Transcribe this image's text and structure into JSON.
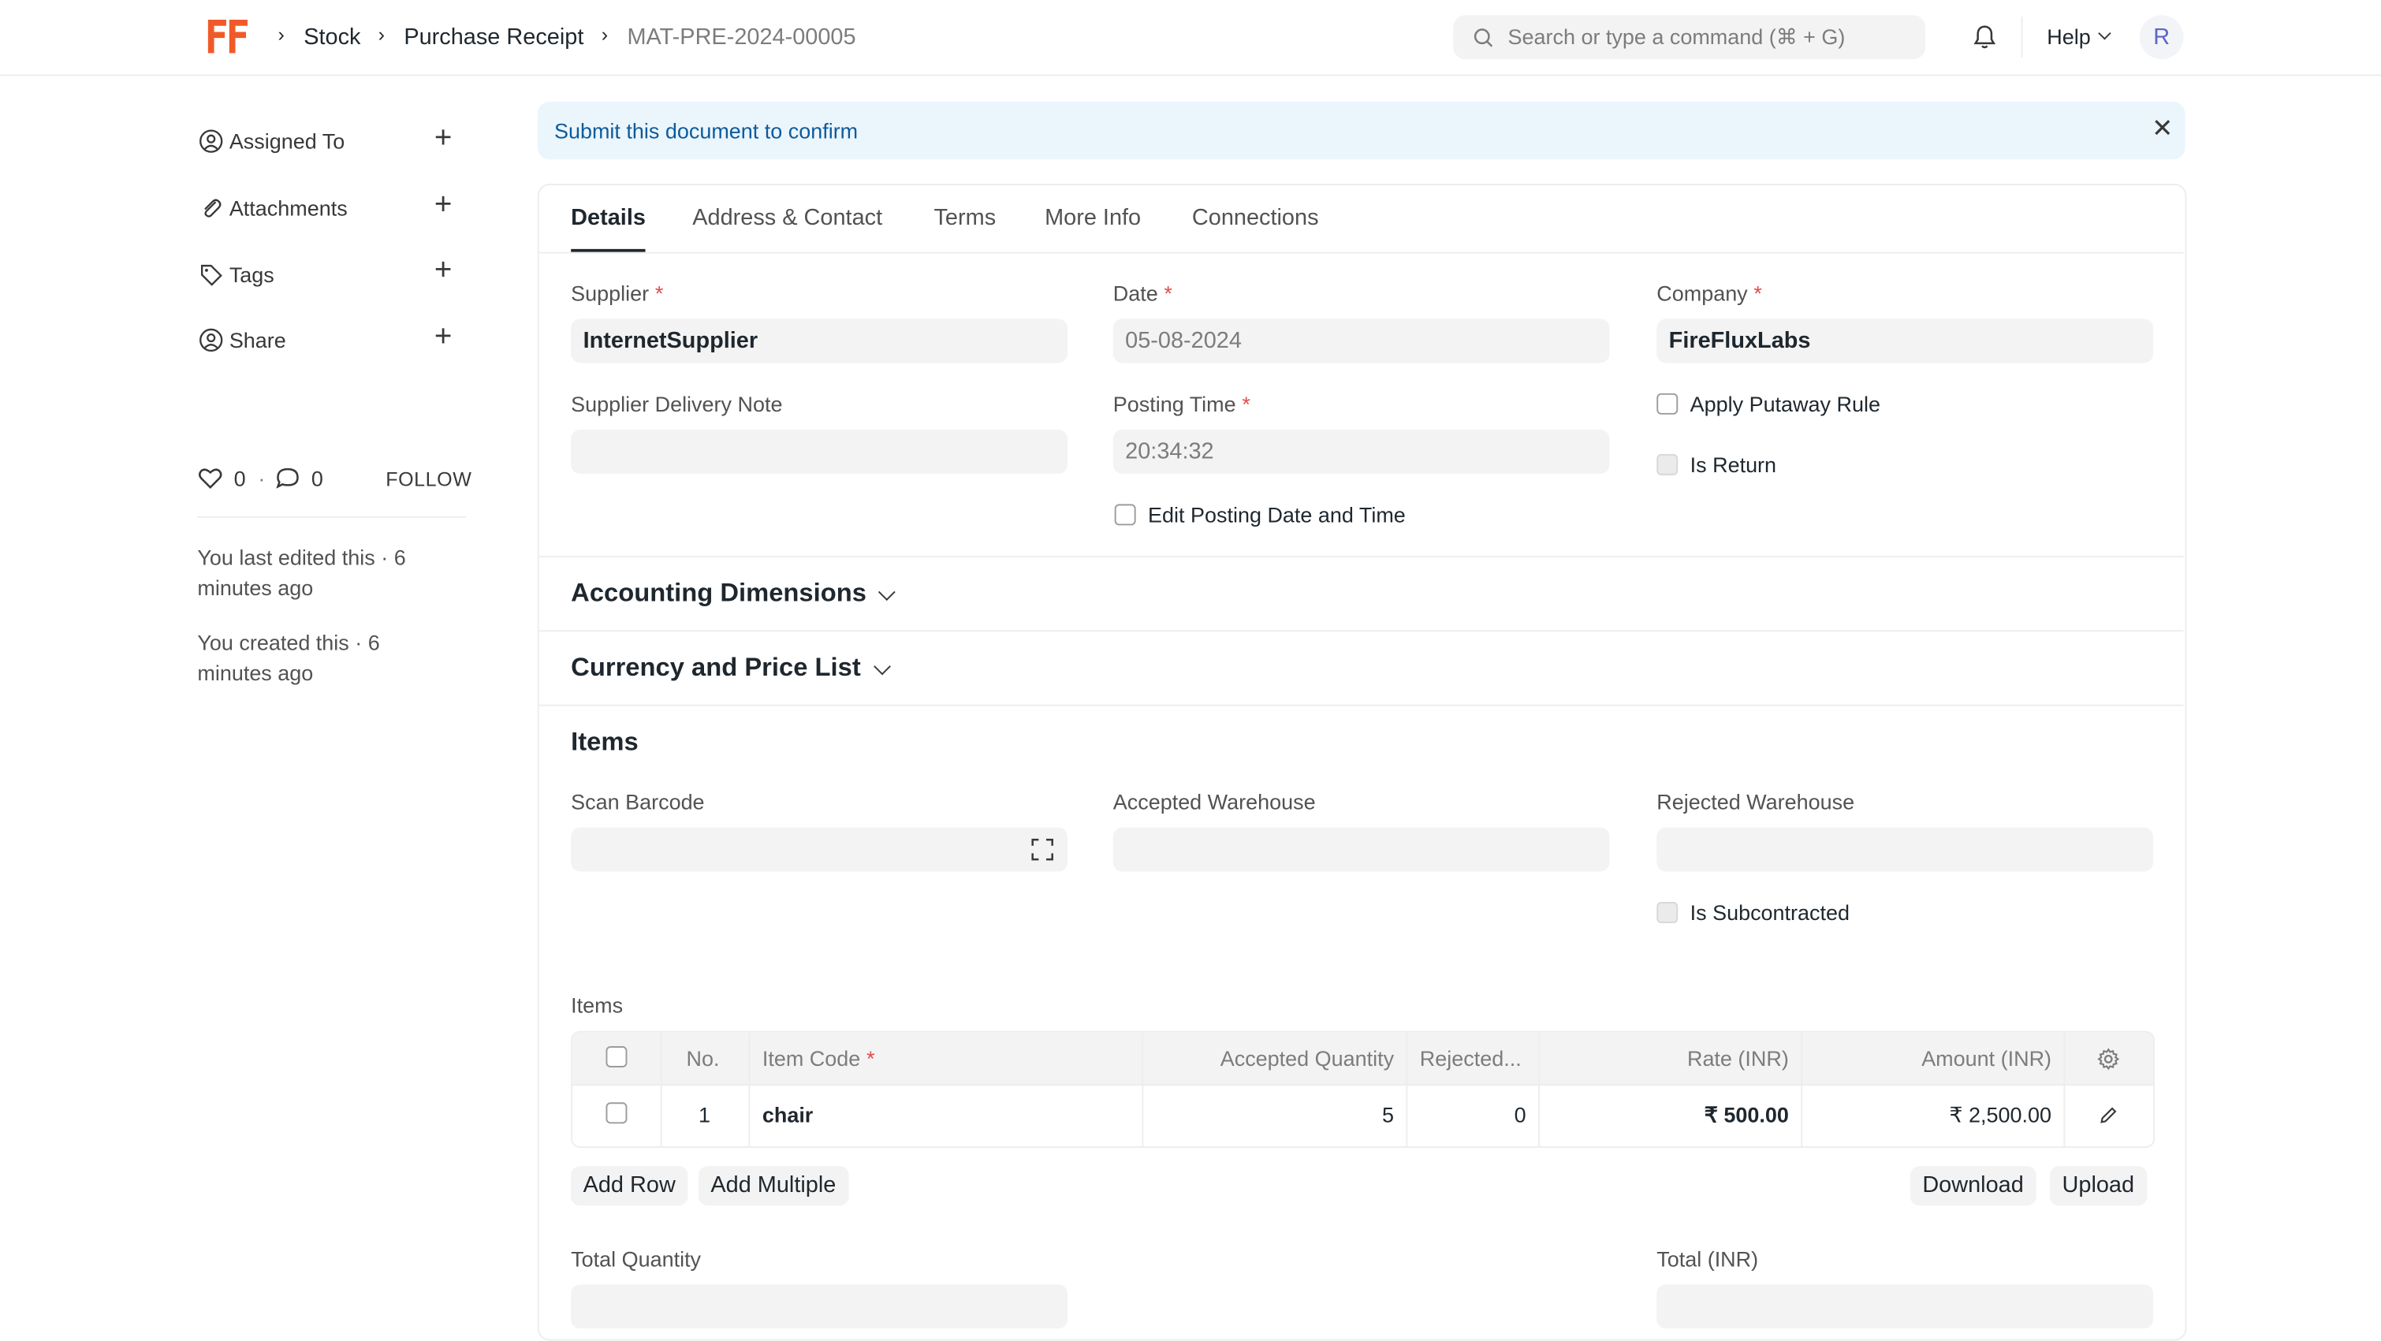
{
  "navbar": {
    "breadcrumbs": [
      "Stock",
      "Purchase Receipt",
      "MAT-PRE-2024-00005"
    ],
    "search_placeholder": "Search or type a command (⌘ + G)",
    "help_label": "Help",
    "avatar_letter": "R",
    "brand_color": "#f05a28"
  },
  "sidebar": {
    "items": [
      {
        "label": "Assigned To",
        "icon": "assign-icon"
      },
      {
        "label": "Attachments",
        "icon": "paperclip-icon"
      },
      {
        "label": "Tags",
        "icon": "tag-icon"
      },
      {
        "label": "Share",
        "icon": "share-icon"
      }
    ],
    "likes": "0",
    "comments": "0",
    "follow_label": "FOLLOW",
    "last_edited": "You last edited this · 6 minutes ago",
    "created": "You created this · 6 minutes ago"
  },
  "alert": {
    "text": "Submit this document to confirm"
  },
  "tabs": [
    "Details",
    "Address & Contact",
    "Terms",
    "More Info",
    "Connections"
  ],
  "details": {
    "supplier_label": "Supplier",
    "supplier_value": "InternetSupplier",
    "date_label": "Date",
    "date_value": "05-08-2024",
    "company_label": "Company",
    "company_value": "FireFluxLabs",
    "delivery_note_label": "Supplier Delivery Note",
    "posting_time_label": "Posting Time",
    "posting_time_value": "20:34:32",
    "apply_putaway_label": "Apply Putaway Rule",
    "is_return_label": "Is Return",
    "edit_posting_label": "Edit Posting Date and Time"
  },
  "sections": {
    "accounting": "Accounting Dimensions",
    "currency": "Currency and Price List",
    "items": "Items"
  },
  "items_section": {
    "scan_barcode_label": "Scan Barcode",
    "accepted_wh_label": "Accepted Warehouse",
    "rejected_wh_label": "Rejected Warehouse",
    "is_subcontracted_label": "Is Subcontracted",
    "table_label": "Items",
    "columns": [
      "No.",
      "Item Code",
      "Accepted Quantity",
      "Rejected...",
      "Rate (INR)",
      "Amount (INR)"
    ],
    "rows": [
      {
        "no": "1",
        "item_code": "chair",
        "accepted_qty": "5",
        "rejected_qty": "0",
        "rate": "₹ 500.00",
        "amount": "₹ 2,500.00"
      }
    ],
    "buttons": {
      "add_row": "Add Row",
      "add_multiple": "Add Multiple",
      "download": "Download",
      "upload": "Upload"
    },
    "total_qty_label": "Total Quantity",
    "total_label": "Total (INR)"
  }
}
